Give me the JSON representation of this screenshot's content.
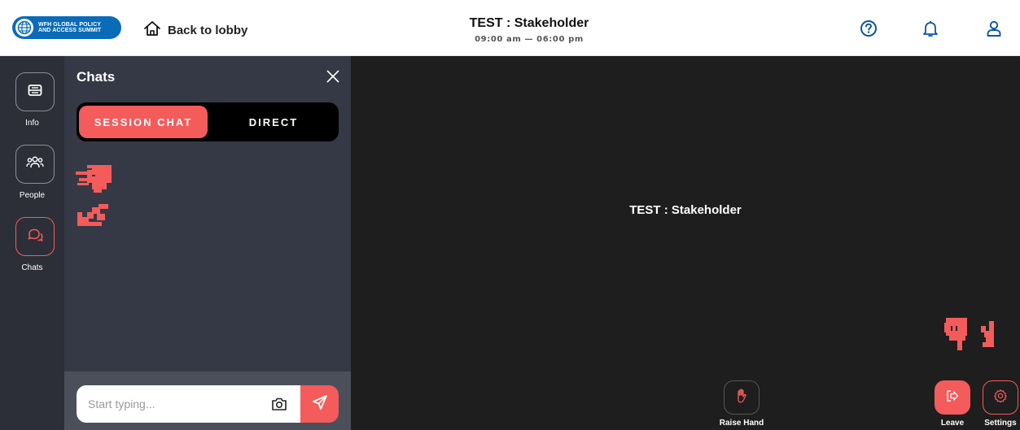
{
  "header": {
    "logo_line1": "WFH GLOBAL POLICY",
    "logo_line2": "AND ACCESS SUMMIT",
    "back_label": "Back to lobby",
    "title": "TEST : Stakeholder",
    "time": "09:00 am — 06:00 pm",
    "icons": [
      "help-icon",
      "bell-icon",
      "user-icon"
    ]
  },
  "rail": {
    "items": [
      {
        "label": "Info",
        "icon": "ticket-icon",
        "active": false
      },
      {
        "label": "People",
        "icon": "people-icon",
        "active": false
      },
      {
        "label": "Chats",
        "icon": "chat-icon",
        "active": true
      }
    ]
  },
  "chat": {
    "title": "Chats",
    "tabs": [
      {
        "label": "SESSION CHAT",
        "active": true
      },
      {
        "label": "DIRECT",
        "active": false
      }
    ],
    "input_placeholder": "Start typing..."
  },
  "stage": {
    "title": "TEST : Stakeholder",
    "controls": [
      {
        "label": "Raise Hand",
        "icon": "hand-icon"
      },
      {
        "label": "Leave",
        "icon": "exit-icon"
      },
      {
        "label": "Settings",
        "icon": "gear-icon"
      }
    ]
  },
  "colors": {
    "accent": "#f45b5b",
    "rail_bg": "#2c2f38",
    "panel_bg": "#353945",
    "stage_bg": "#1e1e1e",
    "logo_bg": "#0a6bb8"
  }
}
